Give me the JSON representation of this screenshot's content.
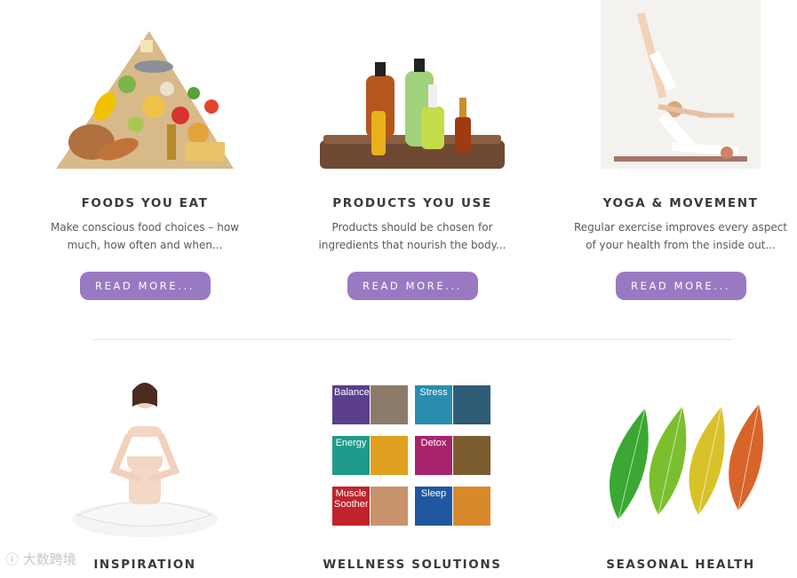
{
  "cards": [
    {
      "title": "FOODS YOU EAT",
      "text": "Make conscious food choices – how much, how often and when...",
      "button": "READ MORE..."
    },
    {
      "title": "PRODUCTS YOU USE",
      "text": "Products should be chosen for ingredients that nourish the body...",
      "button": "READ MORE..."
    },
    {
      "title": "YOGA & MOVEMENT",
      "text": "Regular exercise improves every aspect of your health from the inside out...",
      "button": "READ MORE..."
    }
  ],
  "row2": [
    {
      "title": "INSPIRATION"
    },
    {
      "title": "WELLNESS SOLUTIONS",
      "tiles": [
        "Balance",
        "Stress",
        "Energy",
        "Detox",
        "Muscle Soother",
        "Sleep"
      ]
    },
    {
      "title": "SEASONAL HEALTH"
    }
  ],
  "watermark": "大数跨境",
  "colors": {
    "button": "#9a79c3",
    "divider": "#e3e3e3",
    "title": "#3a3a3a",
    "text": "#595959"
  }
}
